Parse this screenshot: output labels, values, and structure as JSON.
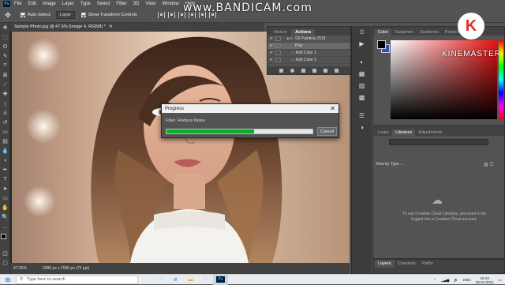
{
  "watermark": {
    "brand": "www.BANDICAM.com"
  },
  "menu": {
    "logo": "Ps",
    "items": [
      "File",
      "Edit",
      "Image",
      "Layer",
      "Type",
      "Select",
      "Filter",
      "3D",
      "View",
      "Window",
      "Help"
    ]
  },
  "options": {
    "auto_select_label": "Auto-Select:",
    "layer_select": "Layer",
    "transform_label": "Show Transform Controls"
  },
  "document": {
    "tab_title": "Sample Photo.jpg @ 47.6% (Image 4, RGB/8) *",
    "zoom": "47.55%",
    "size_info": "2086 px x 2590 px (72 ppi)"
  },
  "history_panel": {
    "tabs": [
      "History",
      "Actions"
    ],
    "active_tab": "Actions",
    "rows": [
      {
        "label": "Oil Painting 2019",
        "checked": true
      },
      {
        "label": "Play",
        "checked": true,
        "selected": true
      },
      {
        "label": "Add Color 1",
        "checked": true
      },
      {
        "label": "Add Color 2",
        "checked": true
      }
    ]
  },
  "color_panel": {
    "tabs": [
      "Color",
      "Swatches",
      "Gradients",
      "Patterns"
    ],
    "fg_color": "#000000",
    "bg_color": "#2255cc"
  },
  "kinemaster": {
    "logo": "K",
    "text": "KINEMASTER"
  },
  "libraries_panel": {
    "tabs": [
      "Learn",
      "Libraries",
      "Adjustments"
    ],
    "active_tab": "Libraries",
    "view_label": "View by Type",
    "message": "To use Creative Cloud Libraries, you need to be logged into a Creative Cloud account."
  },
  "layers_panel": {
    "tabs": [
      "Layers",
      "Channels",
      "Paths"
    ],
    "active_tab": "Layers"
  },
  "progress_dialog": {
    "title": "Progress",
    "message": "Filter: Reduce Noise",
    "percent": 60,
    "cancel_label": "Cancel"
  },
  "taskbar": {
    "search_placeholder": "Type here to search",
    "tray_lang": "ENG",
    "time": "18:44",
    "date": "29-04-2021"
  },
  "colors": {
    "progress_fill": "#06b025",
    "ps_blue": "#31a8ff",
    "kinemaster_red": "#e1302a"
  }
}
